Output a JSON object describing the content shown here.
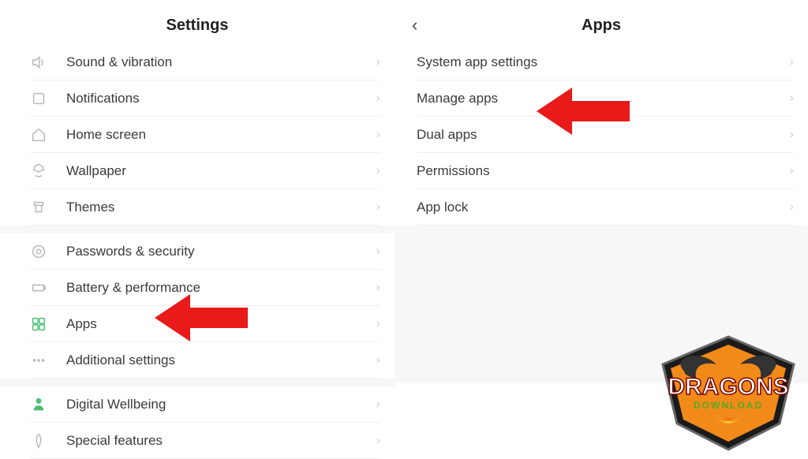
{
  "left": {
    "title": "Settings",
    "groups": [
      [
        {
          "icon": "sound",
          "label": "Sound & vibration"
        },
        {
          "icon": "notify",
          "label": "Notifications"
        },
        {
          "icon": "home",
          "label": "Home screen"
        },
        {
          "icon": "wallpaper",
          "label": "Wallpaper"
        },
        {
          "icon": "theme",
          "label": "Themes"
        }
      ],
      [
        {
          "icon": "lock",
          "label": "Passwords & security"
        },
        {
          "icon": "battery",
          "label": "Battery & performance"
        },
        {
          "icon": "apps",
          "label": "Apps"
        },
        {
          "icon": "dots",
          "label": "Additional settings"
        }
      ],
      [
        {
          "icon": "wellbeing",
          "label": "Digital Wellbeing"
        },
        {
          "icon": "special",
          "label": "Special features"
        }
      ]
    ]
  },
  "right": {
    "title": "Apps",
    "items": [
      {
        "label": "System app settings"
      },
      {
        "label": "Manage apps"
      },
      {
        "label": "Dual apps"
      },
      {
        "label": "Permissions"
      },
      {
        "label": "App lock"
      }
    ]
  },
  "logo_text": "DRAGONS",
  "logo_sub": "DOWNLOAD"
}
